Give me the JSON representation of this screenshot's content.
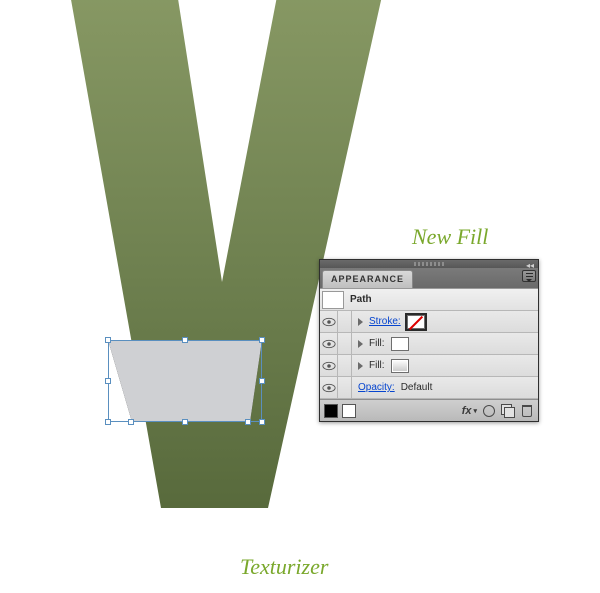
{
  "captions": {
    "new_fill": "New Fill",
    "texturizer": "Texturizer"
  },
  "panel": {
    "title": "APPEARANCE",
    "target": "Path",
    "rows": {
      "stroke_label": "Stroke:",
      "fill_label": "Fill:",
      "opacity_label": "Opacity:",
      "opacity_value": "Default"
    },
    "footer": {
      "fx_label": "fx"
    }
  },
  "colors": {
    "letter_top": "#82935e",
    "letter_bottom": "#5b6b3d",
    "trap_fill": "#cfd0d3",
    "caption": "#7aa82c"
  }
}
